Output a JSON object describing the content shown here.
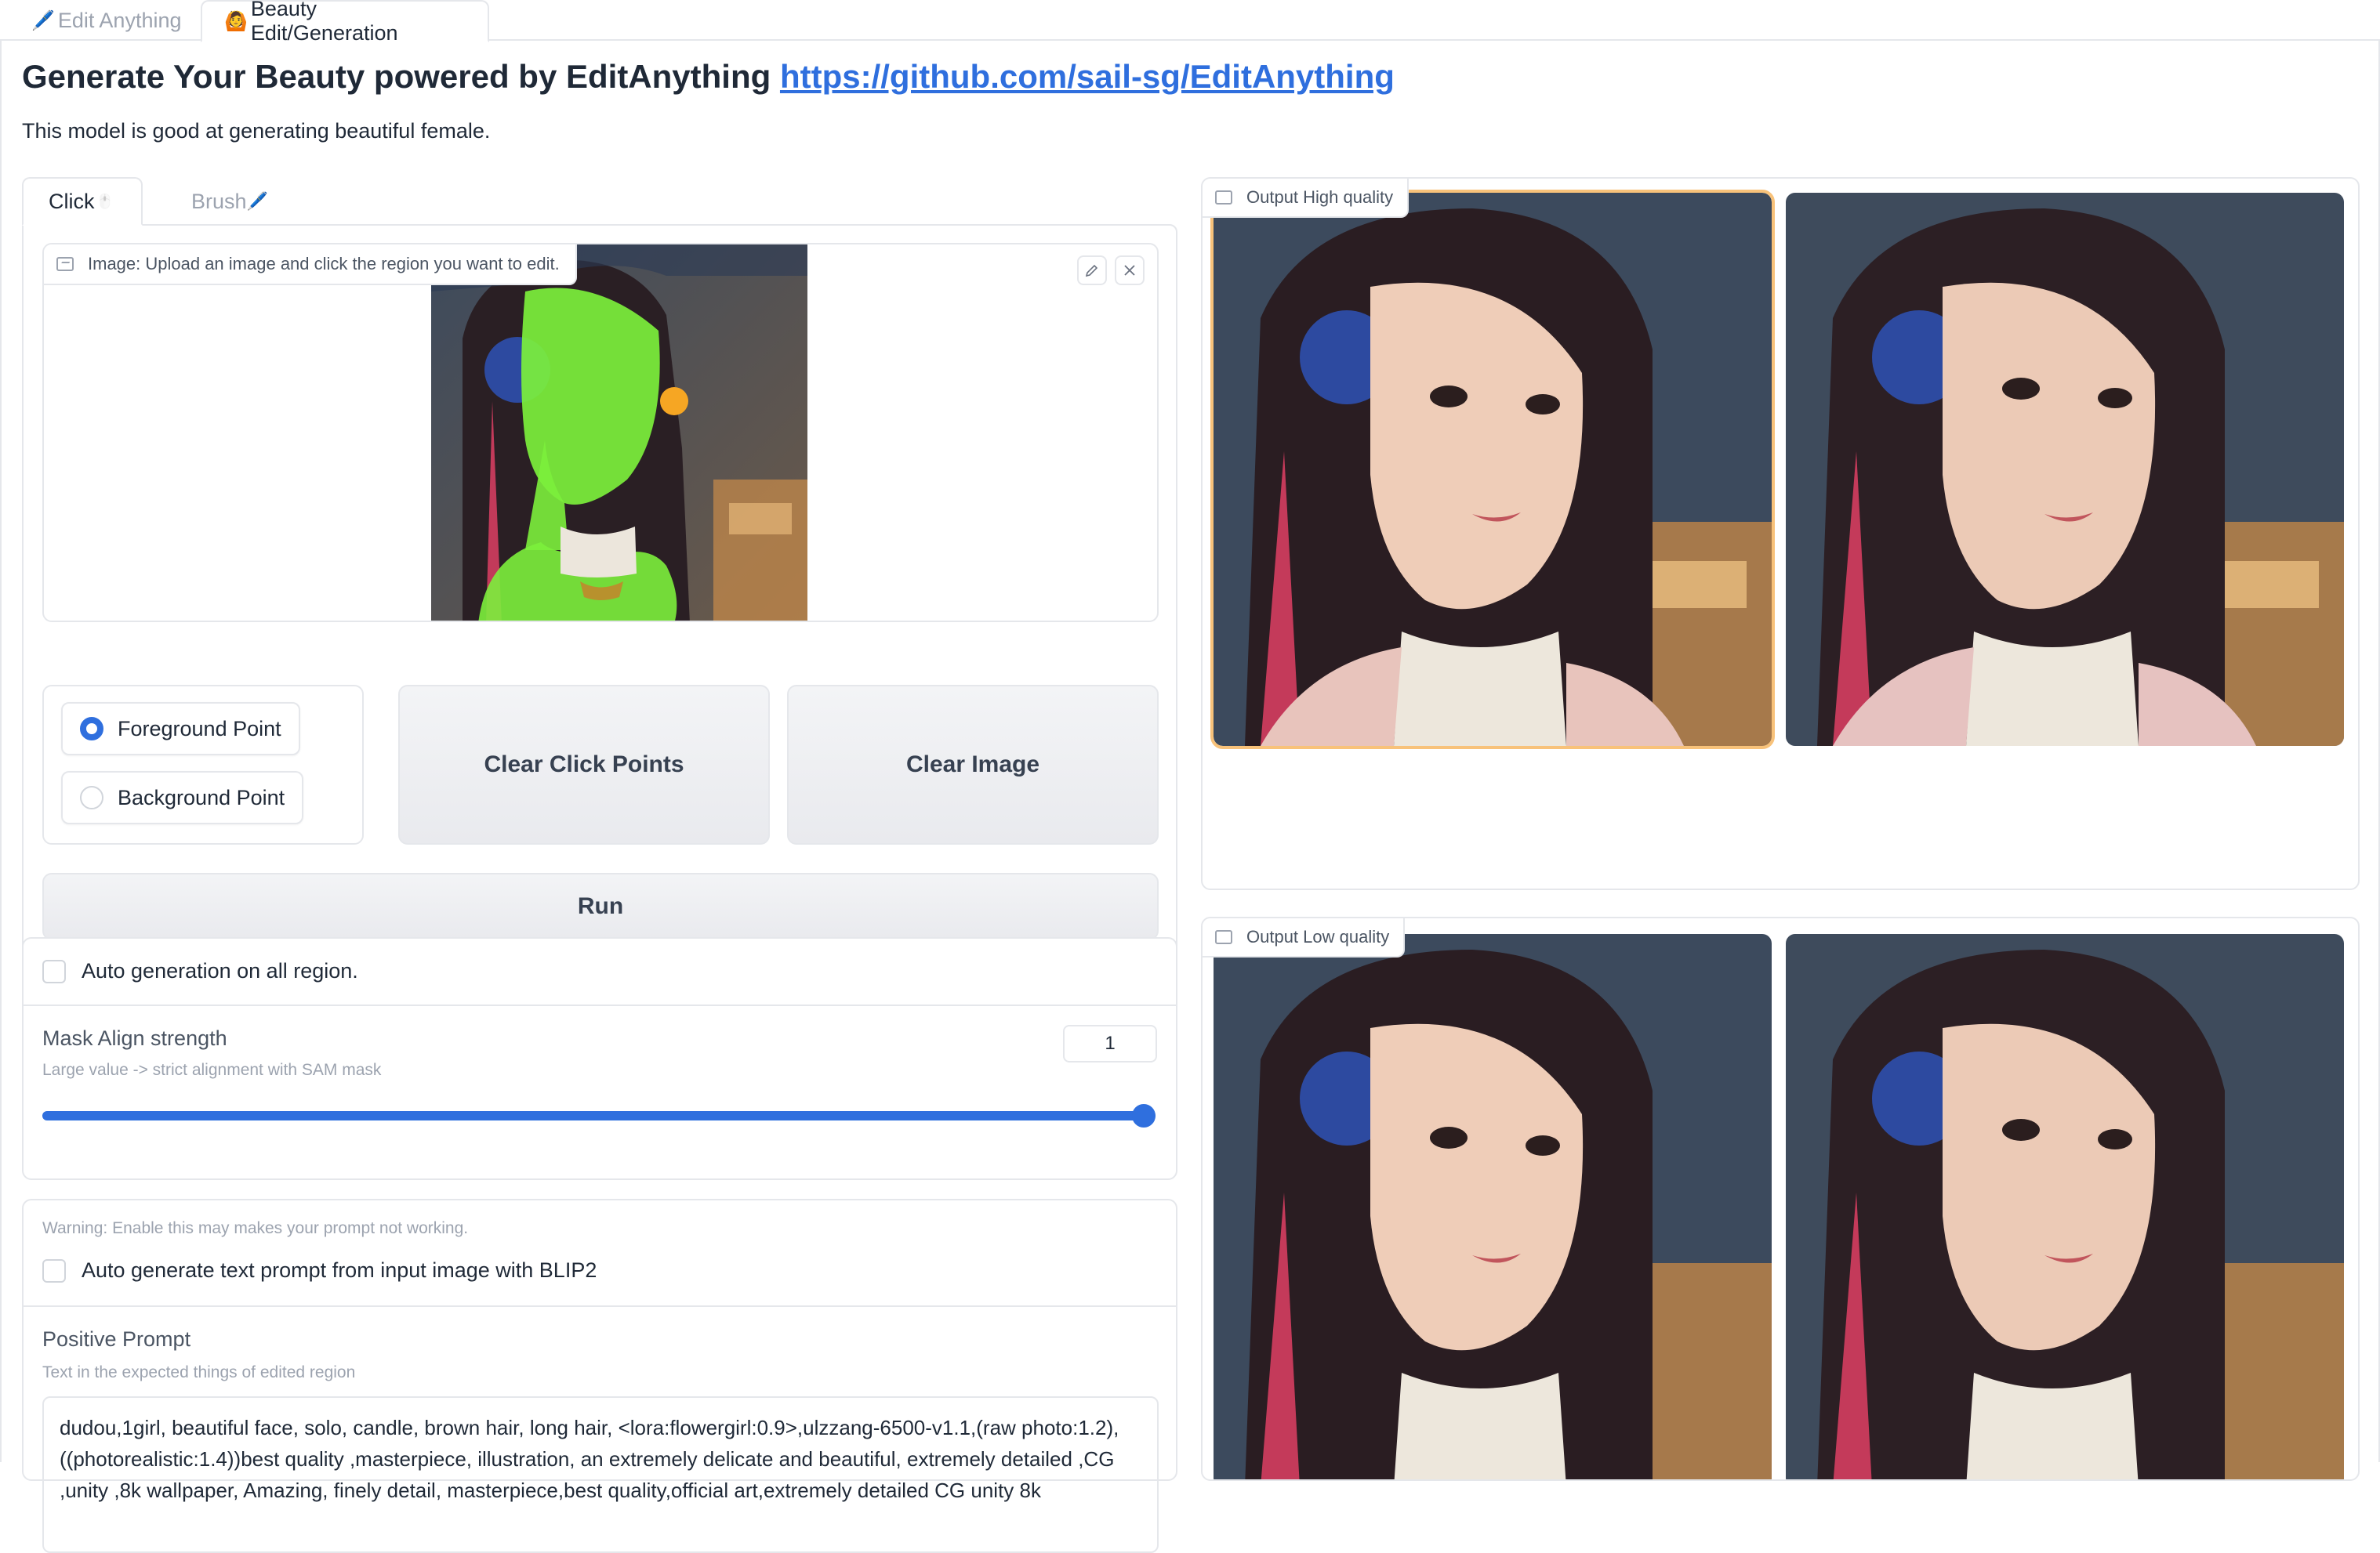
{
  "tabs": [
    {
      "icon": "🖊️",
      "label": "Edit Anything"
    },
    {
      "icon": "🙆",
      "label": "Beauty Edit/Generation"
    }
  ],
  "header": {
    "title": "Generate Your Beauty powered by EditAnything ",
    "link": "https://github.com/sail-sg/EditAnything",
    "description": "This model is good at generating beautiful female."
  },
  "mode_tabs": {
    "click_label": "Click",
    "click_icon": "🖱️",
    "brush_label": "Brush",
    "brush_icon": "🖊️"
  },
  "image_input": {
    "label": "Image: Upload an image and click the region you want to edit."
  },
  "point_type": {
    "options": [
      "Foreground Point",
      "Background Point"
    ],
    "selected": "Foreground Point"
  },
  "buttons": {
    "clear_click_points": "Clear Click Points",
    "clear_image": "Clear Image",
    "run": "Run"
  },
  "auto_generation": {
    "label": "Auto generation on all region.",
    "checked": false
  },
  "mask_align": {
    "label": "Mask Align strength",
    "info": "Large value -> strict alignment with SAM mask",
    "value": "1",
    "fraction": 1.0
  },
  "blip": {
    "warning": "Warning: Enable this may makes your prompt not working.",
    "label": "Auto generate text prompt from input image with BLIP2",
    "checked": false
  },
  "positive_prompt": {
    "label": "Positive Prompt",
    "info": "Text in the expected things of edited region",
    "value": "dudou,1girl, beautiful face, solo, candle, brown hair, long hair, <lora:flowergirl:0.9>,ulzzang-6500-v1.1,(raw photo:1.2),((photorealistic:1.4))best quality ,masterpiece, illustration, an extremely delicate and beautiful, extremely detailed ,CG ,unity ,8k wallpaper, Amazing, finely detail, masterpiece,best quality,official art,extremely detailed CG unity 8k"
  },
  "outputs": {
    "high_label": "Output High quality",
    "low_label": "Output Low quality"
  },
  "colors": {
    "accent": "#2f6fde",
    "mask_green": "#7cf03c",
    "click_point": "#f6a623",
    "selected_outline": "#f8c27a"
  }
}
